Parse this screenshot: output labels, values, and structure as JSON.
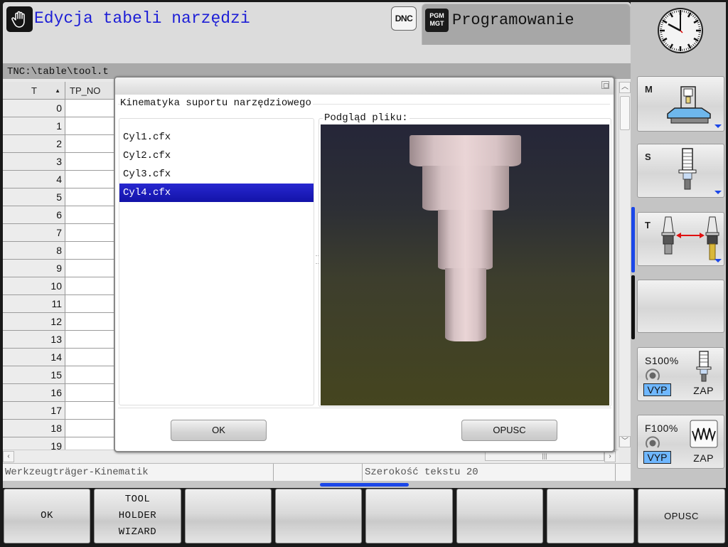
{
  "header": {
    "title": "Edycja tabeli narzędzi",
    "hand_icon": "hand-stop-icon",
    "dnc_label": "DNC",
    "pgm_mgt_label_line1": "PGM",
    "pgm_mgt_label_line2": "MGT",
    "mode_title": "Programowanie"
  },
  "path_bar": {
    "path": "TNC:\\table\\tool.t"
  },
  "tool_table": {
    "columns": [
      {
        "label": "T",
        "sort": "ascending"
      },
      {
        "label": "TP_NO"
      }
    ],
    "rows": [
      {
        "T": "0",
        "TP_NO": ""
      },
      {
        "T": "1",
        "TP_NO": ""
      },
      {
        "T": "2",
        "TP_NO": ""
      },
      {
        "T": "3",
        "TP_NO": ""
      },
      {
        "T": "4",
        "TP_NO": ""
      },
      {
        "T": "5",
        "TP_NO": ""
      },
      {
        "T": "6",
        "TP_NO": ""
      },
      {
        "T": "7",
        "TP_NO": ""
      },
      {
        "T": "8",
        "TP_NO": ""
      },
      {
        "T": "9",
        "TP_NO": ""
      },
      {
        "T": "10",
        "TP_NO": ""
      },
      {
        "T": "11",
        "TP_NO": ""
      },
      {
        "T": "12",
        "TP_NO": ""
      },
      {
        "T": "13",
        "TP_NO": ""
      },
      {
        "T": "14",
        "TP_NO": ""
      },
      {
        "T": "15",
        "TP_NO": ""
      },
      {
        "T": "16",
        "TP_NO": ""
      },
      {
        "T": "17",
        "TP_NO": ""
      },
      {
        "T": "18",
        "TP_NO": ""
      },
      {
        "T": "19",
        "TP_NO": ""
      }
    ]
  },
  "dialog": {
    "group_title": "Kinematyka suportu narzędziowego",
    "files": [
      {
        "name": "Cyl1.cfx",
        "selected": false
      },
      {
        "name": "Cyl2.cfx",
        "selected": false
      },
      {
        "name": "Cyl3.cfx",
        "selected": false
      },
      {
        "name": "Cyl4.cfx",
        "selected": true
      }
    ],
    "preview_label": "Podgląd pliku:",
    "ok_label": "OK",
    "cancel_label": "OPUSC"
  },
  "status_bar": {
    "field_name": "Werkzeugträger-Kinematik",
    "middle": "",
    "text_width": "Szerokość tekstu 20"
  },
  "side_panel": {
    "m_key": "M",
    "s_key": "S",
    "t_key": "T",
    "spindle_override": {
      "label": "S100%",
      "vyp": "VYP",
      "zap": "ZAP",
      "value_percent": 100
    },
    "feed_override": {
      "label": "F100%",
      "vyp": "VYP",
      "zap": "ZAP",
      "value_percent": 100
    },
    "clock_time": "11:50"
  },
  "softkeys": [
    {
      "label": "OK"
    },
    {
      "label_lines": [
        "TOOL",
        "HOLDER",
        "WIZARD"
      ]
    },
    {
      "label": ""
    },
    {
      "label": ""
    },
    {
      "label": ""
    },
    {
      "label": ""
    },
    {
      "label": ""
    },
    {
      "label": "OPUSC"
    }
  ],
  "colors": {
    "title_blue": "#1d1ed6",
    "selection_blue": "#1313a8",
    "accent_blue": "#1b47e8",
    "vyp_blue": "#6fb7ff",
    "arrow_red": "#e01010"
  }
}
